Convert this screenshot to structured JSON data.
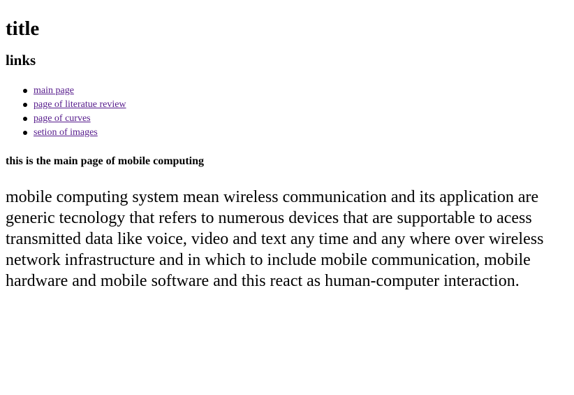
{
  "page": {
    "title": "title",
    "links_heading": "links",
    "links": [
      {
        "label": "main page"
      },
      {
        "label": "page of literatue review"
      },
      {
        "label": "page of curves"
      },
      {
        "label": "setion of images"
      }
    ],
    "subheading": "this is the main page of mobile computing",
    "paragraph": "mobile computing system mean wireless communication and its application are generic tecnology that refers to numerous devices that are supportable to acess transmitted data like voice, video and text any time and any where over wireless network infrastructure and in which to include mobile communication, mobile hardware and mobile software and this react as human-computer interaction."
  },
  "colors": {
    "visited_link": "#551a8b",
    "text": "#000000",
    "background": "#ffffff"
  }
}
